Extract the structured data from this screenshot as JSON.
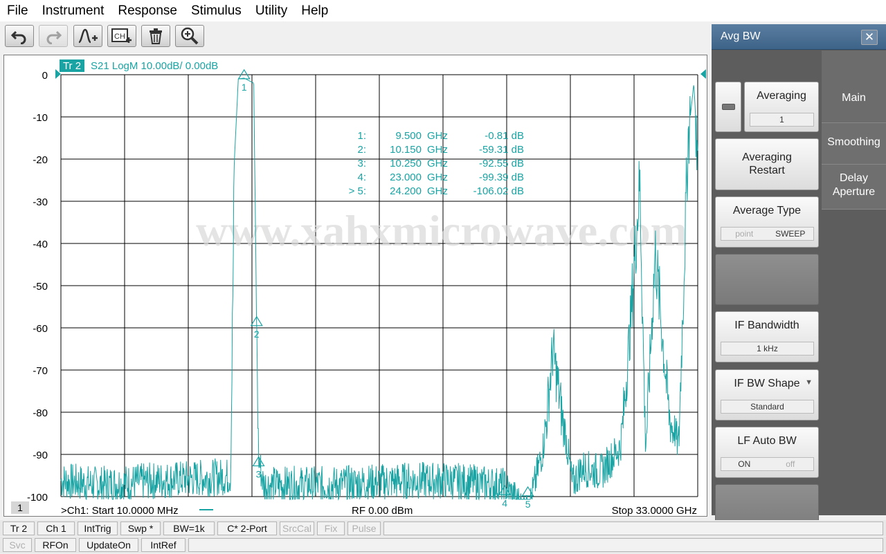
{
  "menu": [
    "File",
    "Instrument",
    "Response",
    "Stimulus",
    "Utility",
    "Help"
  ],
  "toolbar": [
    {
      "name": "undo-button",
      "icon": "undo-icon",
      "disabled": false
    },
    {
      "name": "redo-button",
      "icon": "redo-icon",
      "disabled": true
    },
    {
      "name": "add-marker-button",
      "icon": "marker-add-icon",
      "disabled": false
    },
    {
      "name": "add-channel-button",
      "icon": "channel-add-icon",
      "disabled": false
    },
    {
      "name": "delete-button",
      "icon": "trash-icon",
      "disabled": false
    },
    {
      "name": "zoom-button",
      "icon": "zoom-icon",
      "disabled": false
    }
  ],
  "trace": {
    "tag": "Tr 2",
    "label": "S21 LogM 10.00dB/  0.00dB",
    "color": "#1aa3a3"
  },
  "y_axis": {
    "ticks": [
      "0",
      "-10",
      "-20",
      "-30",
      "-40",
      "-50",
      "-60",
      "-70",
      "-80",
      "-90",
      "-100"
    ]
  },
  "markers": [
    {
      "num": "1:",
      "freq": "9.500",
      "unit": "GHz",
      "value": "-0.81 dB"
    },
    {
      "num": "2:",
      "freq": "10.150",
      "unit": "GHz",
      "value": "-59.31 dB"
    },
    {
      "num": "3:",
      "freq": "10.250",
      "unit": "GHz",
      "value": "-92.55 dB"
    },
    {
      "num": "4:",
      "freq": "23.000",
      "unit": "GHz",
      "value": "-99.39 dB"
    },
    {
      "num": "> 5:",
      "freq": "24.200",
      "unit": "GHz",
      "value": "-106.02 dB"
    }
  ],
  "watermark": "www.xahxmicrowave.com",
  "footer": {
    "channel_badge": "1",
    "start": ">Ch1:  Start   10.0000 MHz",
    "rf": "RF    0.00 dBm",
    "stop": "Stop  33.0000 GHz"
  },
  "panel": {
    "title": "Avg BW",
    "close": "✕",
    "tabs": [
      "Main",
      "Smoothing",
      "Delay Aperture"
    ],
    "averaging_label": "Averaging",
    "averaging_value": "1",
    "averaging_restart": "Averaging Restart",
    "average_type_label": "Average Type",
    "average_type_opts": [
      "point",
      "SWEEP"
    ],
    "if_bw_label": "IF Bandwidth",
    "if_bw_value": "1 kHz",
    "if_shape_label": "IF BW Shape",
    "if_shape_value": "Standard",
    "lf_auto_label": "LF Auto BW",
    "lf_auto_opts": [
      "ON",
      "off"
    ]
  },
  "status_row1": [
    "Tr 2",
    "Ch 1",
    "IntTrig",
    "Swp *",
    "BW=1k",
    "C* 2-Port",
    "SrcCal",
    "Fix",
    "Pulse"
  ],
  "status_row2": [
    "Svc",
    "RFOn",
    "UpdateOn",
    "IntRef"
  ],
  "chart_data": {
    "type": "line",
    "xlabel": "",
    "ylabel": "",
    "x_range_ghz": [
      0.01,
      33.0
    ],
    "ylim": [
      -100,
      0
    ],
    "series": [
      {
        "x": [
          0.01,
          2.0,
          5.0,
          8.8,
          9.0,
          9.2,
          9.5,
          10.0,
          10.15,
          10.25,
          10.5,
          14.0,
          18.0,
          20.0,
          22.5,
          23.0,
          24.2,
          25.0,
          25.5,
          26.5,
          27.0,
          28.0,
          29.0,
          29.5,
          30.0,
          30.3,
          30.8,
          31.5,
          32.0,
          32.5,
          32.8,
          33.0
        ],
        "y": [
          -98,
          -99,
          -98,
          -97,
          -20,
          -1,
          -0.81,
          -2,
          -59.31,
          -92.55,
          -99,
          -99,
          -98,
          -98,
          -99,
          -99.39,
          -106.02,
          -90,
          -65,
          -99,
          -95,
          -96,
          -90,
          -60,
          -25,
          -90,
          -42,
          -80,
          -90,
          -15,
          -2,
          -20
        ]
      }
    ]
  }
}
